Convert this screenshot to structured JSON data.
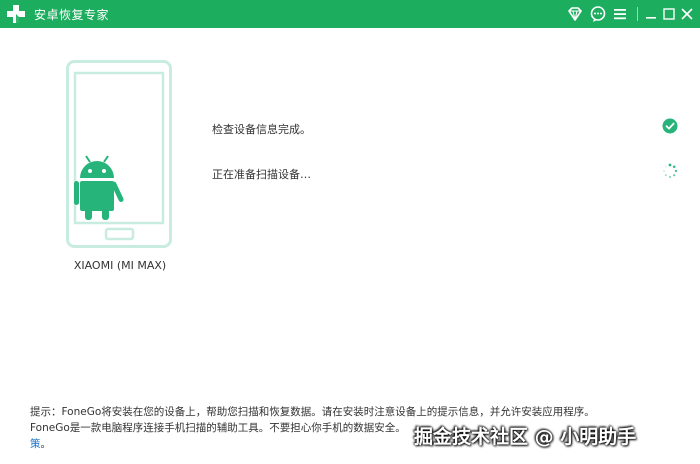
{
  "window": {
    "title": "安卓恢复专家",
    "accent": "#1cae5e",
    "icons": [
      "app-logo-icon",
      "diamond-icon",
      "feedback-icon",
      "menu-icon",
      "minimize-icon",
      "maximize-icon",
      "close-icon"
    ]
  },
  "device": {
    "name": "XIAOMI (MI MAX)",
    "phone_color": "#c8ecdf",
    "android_color": "#26b47a"
  },
  "steps": [
    {
      "label": "检查设备信息完成。",
      "status": "done",
      "status_icon": "check-icon"
    },
    {
      "label": "正在准备扫描设备…",
      "status": "in-progress",
      "status_icon": "spinner-icon"
    }
  ],
  "tips": {
    "line1": "提示：FoneGo将安装在您的设备上，帮助您扫描和恢复数据。请在安装时注意设备上的提示信息，并允许安装应用程序。",
    "line2": "FoneGo是一款电脑程序连接手机扫描的辅助工具。不要担心你手机的数据安全。",
    "line2_tail": "策",
    "line2_end": "。"
  },
  "watermark": "掘金技术社区 @ 小明助手"
}
